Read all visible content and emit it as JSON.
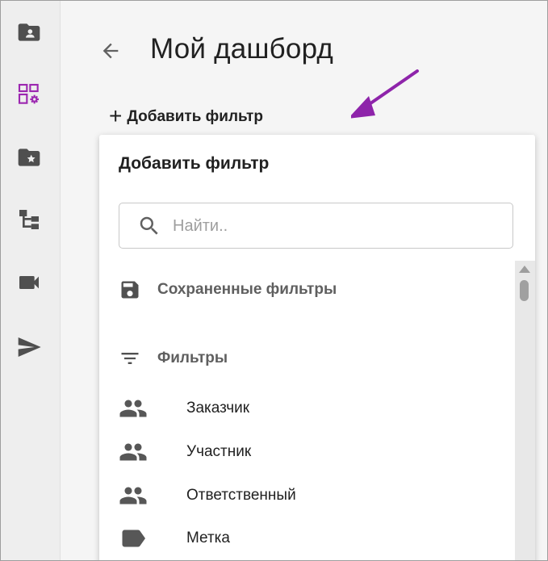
{
  "page": {
    "title": "Мой дашборд",
    "add_filter_label": "Добавить фильтр"
  },
  "sidebar": {
    "items": [
      {
        "icon": "contact-folder-icon"
      },
      {
        "icon": "dashboard-settings-icon",
        "active": true
      },
      {
        "icon": "star-folder-icon"
      },
      {
        "icon": "hierarchy-icon"
      },
      {
        "icon": "video-camera-icon"
      },
      {
        "icon": "send-icon"
      }
    ]
  },
  "dropdown": {
    "title": "Добавить фильтр",
    "search_placeholder": "Найти..",
    "search_value": "",
    "saved_filters_label": "Сохраненные фильтры",
    "filters_section_label": "Фильтры",
    "items": [
      {
        "label": "Заказчик",
        "icon": "people-icon"
      },
      {
        "label": "Участник",
        "icon": "people-icon"
      },
      {
        "label": "Ответственный",
        "icon": "people-icon"
      },
      {
        "label": "Метка",
        "icon": "label-tag-icon"
      }
    ]
  },
  "colors": {
    "accent": "#9c27b0",
    "annotation_arrow": "#8e24aa",
    "icon_dark": "#505050",
    "sidebar_bg": "#eeeeee"
  }
}
